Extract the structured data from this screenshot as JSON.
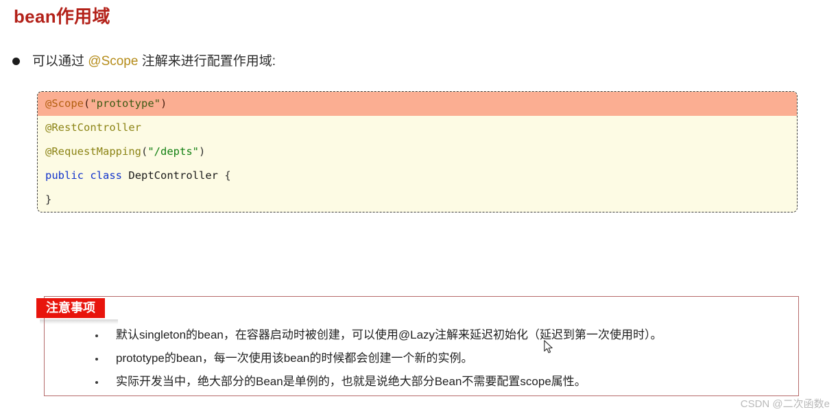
{
  "page": {
    "title": "bean作用域",
    "title_color": "#b32119",
    "background": "#ffffff"
  },
  "intro": {
    "bullet_icon": "filled-circle-bullet",
    "text_before": "可以通过 ",
    "highlight": "@Scope",
    "highlight_color": "#b58c1a",
    "text_after": " 注解来进行配置作用域:"
  },
  "code_block": {
    "border_style": "dashed",
    "background": "#fdfbe4",
    "highlight_background": "#fbae92",
    "lines": [
      {
        "highlighted": true,
        "tokens": [
          {
            "text": "@Scope",
            "type": "annotation"
          },
          {
            "text": "(",
            "type": "punct"
          },
          {
            "text": "\"prototype\"",
            "type": "string"
          },
          {
            "text": ")",
            "type": "punct"
          }
        ]
      },
      {
        "highlighted": false,
        "tokens": [
          {
            "text": "@RestController",
            "type": "annotation"
          }
        ]
      },
      {
        "highlighted": false,
        "tokens": [
          {
            "text": "@RequestMapping",
            "type": "annotation"
          },
          {
            "text": "(",
            "type": "punct"
          },
          {
            "text": "\"/depts\"",
            "type": "string"
          },
          {
            "text": ")",
            "type": "punct"
          }
        ]
      },
      {
        "highlighted": false,
        "tokens": [
          {
            "text": "public",
            "type": "keyword"
          },
          {
            "text": " ",
            "type": "punct"
          },
          {
            "text": "class",
            "type": "keyword"
          },
          {
            "text": " ",
            "type": "punct"
          },
          {
            "text": "DeptController",
            "type": "type"
          },
          {
            "text": " {",
            "type": "punct"
          }
        ]
      },
      {
        "highlighted": false,
        "tokens": [
          {
            "text": "}",
            "type": "punct"
          }
        ]
      }
    ]
  },
  "notice": {
    "badge_label": "注意事项",
    "badge_color": "#e8140c",
    "border_color": "#b56a6a",
    "items": [
      "默认singleton的bean，在容器启动时被创建，可以使用@Lazy注解来延迟初始化（延迟到第一次使用时）。",
      "prototype的bean，每一次使用该bean的时候都会创建一个新的实例。",
      "实际开发当中，绝大部分的Bean是单例的，也就是说绝大部分Bean不需要配置scope属性。"
    ]
  },
  "watermark": {
    "text": "CSDN @二次函数e"
  }
}
